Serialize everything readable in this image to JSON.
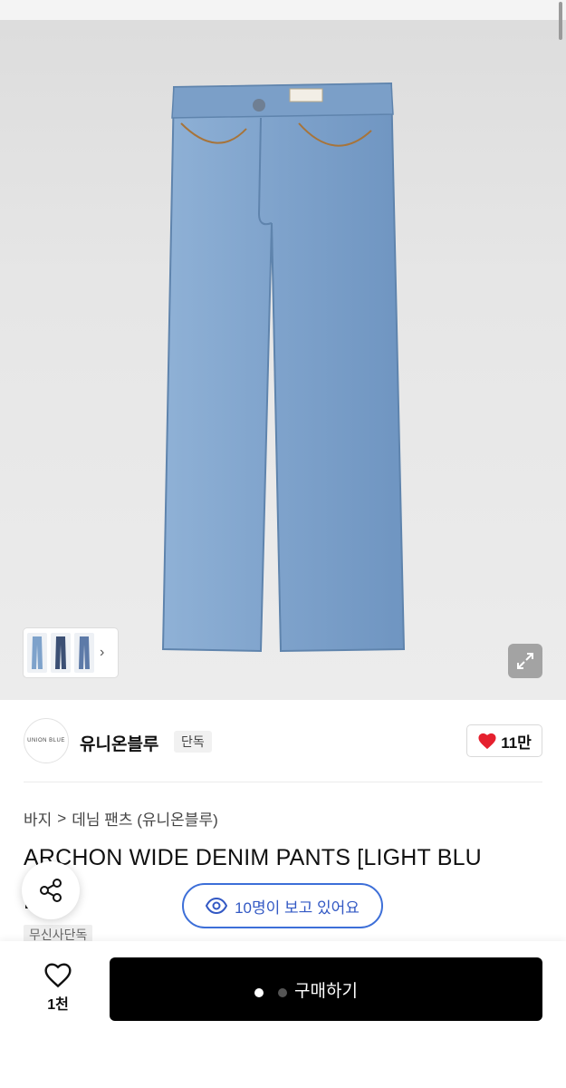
{
  "product": {
    "gallery": {
      "thumbnail_count": 3,
      "next_icon": "chevron-right-icon",
      "expand_icon": "expand-icon"
    },
    "brand": {
      "logo_text": "UNION BLUE",
      "name": "유니온블루",
      "badge": "단독"
    },
    "likes": {
      "icon": "heart-icon",
      "count": "11만",
      "heart_color": "#e5202e"
    },
    "breadcrumb": {
      "level1": "바지",
      "separator": ">",
      "level2": "데님 팬츠 (유니온블루)"
    },
    "title_line1": "ARCHON WIDE DENIM PANTS [LIGHT BLU",
    "title_line2": "E]",
    "tag": "무신사단독"
  },
  "floating": {
    "share_icon": "share-icon",
    "viewers_icon": "eye-icon",
    "viewers_text": "10명이 보고 있어요",
    "accent": "#3d6fd8"
  },
  "bottom_bar": {
    "favorite_icon": "heart-outline-icon",
    "favorite_count": "1천",
    "buy_label": "구매하기"
  }
}
